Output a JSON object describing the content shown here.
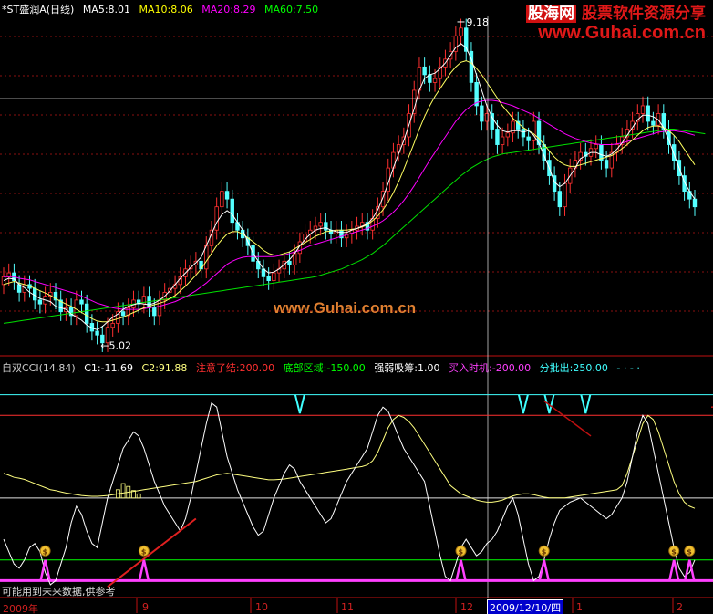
{
  "header": {
    "stock": "*ST盛润A(日线)",
    "ma": [
      {
        "label": "MA5:8.01",
        "color": "#ffffff"
      },
      {
        "label": "MA10:8.06",
        "color": "#ffff00"
      },
      {
        "label": "MA20:8.29",
        "color": "#ff00ff"
      },
      {
        "label": "MA60:7.50",
        "color": "#00ff00"
      }
    ]
  },
  "watermark": {
    "brand": "股海网",
    "slogan": "股票软件资源分享",
    "url": "www.Guhai.com.cn",
    "center": "www.Guhai.com.cn"
  },
  "indicator_header": [
    {
      "label": "自双CCI(14,84)",
      "color": "#cccccc"
    },
    {
      "label": "C1:-11.69",
      "color": "#ffffff"
    },
    {
      "label": "C2:91.88",
      "color": "#ffff80"
    },
    {
      "label": "注意了结:200.00",
      "color": "#ff3030"
    },
    {
      "label": "底部区域:-150.00",
      "color": "#00ff00"
    },
    {
      "label": "强弱吸筹:1.00",
      "color": "#ffffff"
    },
    {
      "label": "买入时机:-200.00",
      "color": "#ff40ff"
    },
    {
      "label": "分批出:250.00",
      "color": "#40ffff"
    },
    {
      "label": "- · - ·",
      "color": "#40ffff"
    }
  ],
  "note": "可能用到未来数据,供参考",
  "x_labels": {
    "year": "2009年",
    "months": [
      "9",
      "10",
      "11",
      "12",
      "1",
      "2"
    ],
    "cursor_date": "2009/12/10/四"
  },
  "chart_data": [
    {
      "type": "candlestick",
      "annotations": [
        {
          "text": "9.18",
          "kind": "high"
        },
        {
          "text": "←5.02",
          "kind": "low"
        }
      ],
      "high_value": 9.18,
      "low_value": 5.02,
      "ylim": [
        5.0,
        9.25
      ],
      "close": [
        5.9,
        5.95,
        5.85,
        5.7,
        5.8,
        5.75,
        5.6,
        5.55,
        5.65,
        5.7,
        5.6,
        5.45,
        5.5,
        5.4,
        5.6,
        5.55,
        5.3,
        5.2,
        5.15,
        5.05,
        5.25,
        5.3,
        5.45,
        5.4,
        5.5,
        5.6,
        5.55,
        5.65,
        5.5,
        5.4,
        5.6,
        5.7,
        5.75,
        5.8,
        5.9,
        6.0,
        6.05,
        6.1,
        6.0,
        6.3,
        6.5,
        6.8,
        7.0,
        6.9,
        6.6,
        6.5,
        6.4,
        6.3,
        6.1,
        6.0,
        5.9,
        5.85,
        5.95,
        6.0,
        6.1,
        6.05,
        6.2,
        6.35,
        6.45,
        6.5,
        6.55,
        6.6,
        6.5,
        6.45,
        6.5,
        6.4,
        6.45,
        6.5,
        6.55,
        6.6,
        6.5,
        6.65,
        6.8,
        7.0,
        7.3,
        7.5,
        7.6,
        7.7,
        8.0,
        8.3,
        8.6,
        8.5,
        8.4,
        8.45,
        8.6,
        8.7,
        8.8,
        9.0,
        9.1,
        8.8,
        8.4,
        8.1,
        7.9,
        8.0,
        7.8,
        7.6,
        7.7,
        7.75,
        7.9,
        7.8,
        7.7,
        7.65,
        7.9,
        7.6,
        7.4,
        7.2,
        7.0,
        6.8,
        7.1,
        7.3,
        7.4,
        7.5,
        7.45,
        7.55,
        7.6,
        7.4,
        7.3,
        7.5,
        7.6,
        7.7,
        7.8,
        7.9,
        8.0,
        8.1,
        7.9,
        7.85,
        8.0,
        7.8,
        7.6,
        7.4,
        7.2,
        7.0,
        6.9,
        6.8
      ],
      "open": [
        5.8,
        5.9,
        5.95,
        5.8,
        5.7,
        5.8,
        5.75,
        5.6,
        5.55,
        5.65,
        5.7,
        5.6,
        5.45,
        5.5,
        5.4,
        5.6,
        5.55,
        5.3,
        5.2,
        5.15,
        5.05,
        5.25,
        5.3,
        5.45,
        5.4,
        5.5,
        5.6,
        5.55,
        5.65,
        5.5,
        5.4,
        5.6,
        5.7,
        5.75,
        5.8,
        5.9,
        6.0,
        6.05,
        6.1,
        6.0,
        6.3,
        6.5,
        6.8,
        7.0,
        6.9,
        6.6,
        6.5,
        6.4,
        6.3,
        6.1,
        6.0,
        5.9,
        5.85,
        5.95,
        6.0,
        6.1,
        6.05,
        6.2,
        6.35,
        6.45,
        6.5,
        6.55,
        6.6,
        6.5,
        6.45,
        6.5,
        6.4,
        6.45,
        6.5,
        6.55,
        6.6,
        6.5,
        6.65,
        6.8,
        7.0,
        7.3,
        7.5,
        7.6,
        7.7,
        8.0,
        8.3,
        8.6,
        8.5,
        8.4,
        8.45,
        8.6,
        8.7,
        8.8,
        9.0,
        9.1,
        8.8,
        8.4,
        8.1,
        7.9,
        8.0,
        7.8,
        7.6,
        7.7,
        7.75,
        7.9,
        7.8,
        7.7,
        7.65,
        7.9,
        7.6,
        7.4,
        7.2,
        7.0,
        6.8,
        7.1,
        7.3,
        7.4,
        7.5,
        7.45,
        7.55,
        7.6,
        7.4,
        7.3,
        7.5,
        7.6,
        7.7,
        7.8,
        7.9,
        8.0,
        8.1,
        7.9,
        7.85,
        8.0,
        7.8,
        7.6,
        7.4,
        7.2,
        7.0,
        6.9
      ],
      "ma5": [
        5.85,
        5.88,
        5.87,
        5.8,
        5.76,
        5.7,
        5.66,
        5.62,
        5.6,
        5.58,
        5.52,
        5.5,
        5.48,
        5.42,
        5.38,
        5.34,
        5.28,
        5.24,
        5.22,
        5.26,
        5.32,
        5.38,
        5.42,
        5.48,
        5.52,
        5.54,
        5.56,
        5.55,
        5.54,
        5.56,
        5.6,
        5.65,
        5.72,
        5.8,
        5.88,
        5.95,
        6.02,
        6.08,
        6.15,
        6.3,
        6.45,
        6.6,
        6.7,
        6.75,
        6.7,
        6.6,
        6.5,
        6.35,
        6.2,
        6.1,
        6.0,
        5.95,
        5.96,
        6.0,
        6.06,
        6.12,
        6.2,
        6.3,
        6.38,
        6.45,
        6.5,
        6.52,
        6.53,
        6.5,
        6.48,
        6.47,
        6.47,
        6.5,
        6.52,
        6.55,
        6.58,
        6.65,
        6.76,
        6.92,
        7.1,
        7.3,
        7.48,
        7.65,
        7.85,
        8.06,
        8.3,
        8.45,
        8.5,
        8.52,
        8.58,
        8.65,
        8.75,
        8.85,
        8.9,
        8.85,
        8.7,
        8.5,
        8.3,
        8.1,
        7.95,
        7.85,
        7.78,
        7.76,
        7.78,
        7.78,
        7.76,
        7.78,
        7.72,
        7.62,
        7.46,
        7.3,
        7.12,
        7.06,
        7.1,
        7.2,
        7.3,
        7.42,
        7.46,
        7.5,
        7.5,
        7.47,
        7.45,
        7.48,
        7.54,
        7.62,
        7.72,
        7.82,
        7.92,
        7.98,
        7.98,
        7.96,
        7.92,
        7.82,
        7.66,
        7.48,
        7.3,
        7.12,
        7.0,
        6.9
      ],
      "ma10": [
        5.8,
        5.82,
        5.84,
        5.82,
        5.8,
        5.78,
        5.75,
        5.72,
        5.69,
        5.66,
        5.62,
        5.58,
        5.55,
        5.52,
        5.48,
        5.44,
        5.4,
        5.36,
        5.33,
        5.32,
        5.32,
        5.34,
        5.36,
        5.38,
        5.41,
        5.44,
        5.47,
        5.5,
        5.52,
        5.54,
        5.56,
        5.58,
        5.62,
        5.66,
        5.72,
        5.78,
        5.85,
        5.92,
        6.0,
        6.1,
        6.2,
        6.3,
        6.38,
        6.45,
        6.48,
        6.48,
        6.45,
        6.4,
        6.35,
        6.3,
        6.24,
        6.2,
        6.18,
        6.18,
        6.2,
        6.22,
        6.26,
        6.3,
        6.34,
        6.38,
        6.42,
        6.45,
        6.48,
        6.49,
        6.5,
        6.5,
        6.5,
        6.51,
        6.52,
        6.54,
        6.57,
        6.62,
        6.68,
        6.76,
        6.86,
        6.98,
        7.12,
        7.28,
        7.45,
        7.62,
        7.8,
        7.96,
        8.1,
        8.22,
        8.32,
        8.42,
        8.52,
        8.6,
        8.66,
        8.68,
        8.65,
        8.58,
        8.5,
        8.4,
        8.3,
        8.2,
        8.1,
        8.02,
        7.94,
        7.88,
        7.82,
        7.78,
        7.74,
        7.68,
        7.6,
        7.52,
        7.44,
        7.38,
        7.34,
        7.32,
        7.32,
        7.34,
        7.36,
        7.38,
        7.4,
        7.42,
        7.44,
        7.46,
        7.5,
        7.55,
        7.6,
        7.66,
        7.72,
        7.78,
        7.82,
        7.84,
        7.84,
        7.82,
        7.78,
        7.72,
        7.64,
        7.54,
        7.44,
        7.34
      ],
      "ma20": [
        5.9,
        5.9,
        5.9,
        5.88,
        5.87,
        5.86,
        5.84,
        5.82,
        5.8,
        5.78,
        5.76,
        5.74,
        5.72,
        5.7,
        5.68,
        5.65,
        5.62,
        5.59,
        5.56,
        5.54,
        5.52,
        5.5,
        5.49,
        5.48,
        5.48,
        5.48,
        5.48,
        5.49,
        5.5,
        5.51,
        5.52,
        5.54,
        5.56,
        5.58,
        5.61,
        5.64,
        5.68,
        5.72,
        5.77,
        5.82,
        5.88,
        5.94,
        6.0,
        6.06,
        6.1,
        6.13,
        6.15,
        6.16,
        6.16,
        6.16,
        6.16,
        6.16,
        6.16,
        6.17,
        6.18,
        6.2,
        6.22,
        6.24,
        6.27,
        6.3,
        6.32,
        6.34,
        6.36,
        6.38,
        6.4,
        6.42,
        6.44,
        6.46,
        6.48,
        6.5,
        6.52,
        6.55,
        6.58,
        6.62,
        6.67,
        6.73,
        6.8,
        6.88,
        6.97,
        7.07,
        7.18,
        7.29,
        7.4,
        7.5,
        7.6,
        7.7,
        7.8,
        7.9,
        7.98,
        8.05,
        8.1,
        8.14,
        8.16,
        8.17,
        8.17,
        8.16,
        8.14,
        8.12,
        8.1,
        8.07,
        8.04,
        8.01,
        7.98,
        7.94,
        7.9,
        7.86,
        7.82,
        7.78,
        7.74,
        7.71,
        7.68,
        7.66,
        7.64,
        7.62,
        7.61,
        7.6,
        7.6,
        7.6,
        7.61,
        7.62,
        7.64,
        7.66,
        7.68,
        7.7,
        7.72,
        7.74,
        7.76,
        7.77,
        7.78,
        7.78,
        7.77,
        7.76,
        7.74,
        7.72
      ],
      "ma60": [
        5.3,
        5.31,
        5.32,
        5.33,
        5.34,
        5.35,
        5.36,
        5.37,
        5.38,
        5.39,
        5.4,
        5.41,
        5.42,
        5.43,
        5.44,
        5.45,
        5.46,
        5.47,
        5.48,
        5.49,
        5.5,
        5.51,
        5.52,
        5.53,
        5.54,
        5.55,
        5.56,
        5.57,
        5.58,
        5.59,
        5.6,
        5.61,
        5.62,
        5.63,
        5.64,
        5.65,
        5.66,
        5.67,
        5.68,
        5.69,
        5.7,
        5.71,
        5.72,
        5.73,
        5.74,
        5.75,
        5.76,
        5.77,
        5.78,
        5.79,
        5.8,
        5.81,
        5.82,
        5.83,
        5.84,
        5.85,
        5.86,
        5.87,
        5.88,
        5.89,
        5.9,
        5.92,
        5.94,
        5.96,
        5.98,
        6.0,
        6.03,
        6.06,
        6.09,
        6.12,
        6.16,
        6.2,
        6.25,
        6.3,
        6.36,
        6.42,
        6.48,
        6.54,
        6.6,
        6.66,
        6.72,
        6.78,
        6.84,
        6.9,
        6.96,
        7.02,
        7.08,
        7.14,
        7.2,
        7.25,
        7.3,
        7.34,
        7.38,
        7.41,
        7.44,
        7.46,
        7.48,
        7.49,
        7.5,
        7.51,
        7.52,
        7.53,
        7.54,
        7.55,
        7.56,
        7.57,
        7.58,
        7.59,
        7.6,
        7.61,
        7.62,
        7.63,
        7.64,
        7.65,
        7.66,
        7.67,
        7.68,
        7.69,
        7.7,
        7.71,
        7.72,
        7.73,
        7.74,
        7.75,
        7.76,
        7.77,
        7.78,
        7.79,
        7.8,
        7.8,
        7.79,
        7.78,
        7.77,
        7.76,
        7.75,
        7.74
      ]
    },
    {
      "type": "line",
      "title": "自双CCI(14,84)",
      "ylim": [
        -230,
        300
      ],
      "levels": [
        {
          "name": "注意了结",
          "value": 200,
          "color": "#ff3030"
        },
        {
          "name": "底部区域",
          "value": -150,
          "color": "#00ff00"
        },
        {
          "name": "买入时机",
          "value": -200,
          "color": "#ff40ff"
        },
        {
          "name": "分批出",
          "value": 250,
          "color": "#40ffff"
        }
      ],
      "series": [
        {
          "name": "C1",
          "color": "#ffffff",
          "values": [
            -100,
            -130,
            -160,
            -170,
            -150,
            -120,
            -110,
            -130,
            -180,
            -210,
            -200,
            -160,
            -120,
            -60,
            -20,
            -40,
            -80,
            -110,
            -120,
            -60,
            0,
            40,
            80,
            120,
            140,
            160,
            150,
            120,
            80,
            40,
            10,
            -20,
            -40,
            -60,
            -80,
            -50,
            0,
            60,
            120,
            180,
            230,
            220,
            160,
            100,
            60,
            20,
            -10,
            -40,
            -70,
            -90,
            -80,
            -40,
            0,
            30,
            60,
            80,
            70,
            40,
            20,
            0,
            -20,
            -40,
            -60,
            -50,
            -20,
            10,
            40,
            60,
            80,
            100,
            120,
            160,
            200,
            220,
            210,
            180,
            150,
            120,
            100,
            80,
            60,
            40,
            -20,
            -80,
            -140,
            -190,
            -200,
            -160,
            -120,
            -100,
            -120,
            -140,
            -130,
            -110,
            -100,
            -80,
            -50,
            -20,
            0,
            -40,
            -100,
            -160,
            -200,
            -190,
            -150,
            -100,
            -60,
            -30,
            -20,
            -10,
            -5,
            0,
            -10,
            -20,
            -30,
            -40,
            -50,
            -40,
            -20,
            0,
            40,
            100,
            160,
            200,
            180,
            120,
            60,
            0,
            -60,
            -120,
            -170,
            -190,
            -180,
            -150
          ]
        },
        {
          "name": "C2",
          "color": "#ffff80",
          "values": [
            60,
            55,
            50,
            48,
            45,
            40,
            35,
            30,
            25,
            20,
            18,
            15,
            12,
            10,
            8,
            6,
            5,
            4,
            4,
            5,
            6,
            8,
            10,
            12,
            14,
            16,
            18,
            20,
            22,
            24,
            26,
            28,
            30,
            32,
            34,
            36,
            38,
            40,
            44,
            48,
            52,
            56,
            58,
            60,
            58,
            56,
            54,
            52,
            50,
            48,
            46,
            44,
            44,
            45,
            46,
            48,
            50,
            52,
            54,
            56,
            58,
            60,
            62,
            64,
            66,
            68,
            70,
            72,
            74,
            76,
            80,
            90,
            110,
            140,
            170,
            190,
            200,
            195,
            185,
            170,
            150,
            130,
            110,
            90,
            70,
            50,
            30,
            20,
            10,
            5,
            0,
            -5,
            -8,
            -10,
            -10,
            -8,
            -5,
            0,
            5,
            8,
            10,
            10,
            8,
            5,
            2,
            0,
            0,
            0,
            0,
            2,
            4,
            6,
            8,
            10,
            12,
            14,
            16,
            18,
            20,
            30,
            60,
            100,
            140,
            180,
            200,
            190,
            160,
            120,
            80,
            40,
            10,
            -10,
            -20,
            -25,
            -20
          ]
        }
      ],
      "signals": [
        8,
        27,
        88,
        104,
        129,
        132
      ]
    }
  ]
}
